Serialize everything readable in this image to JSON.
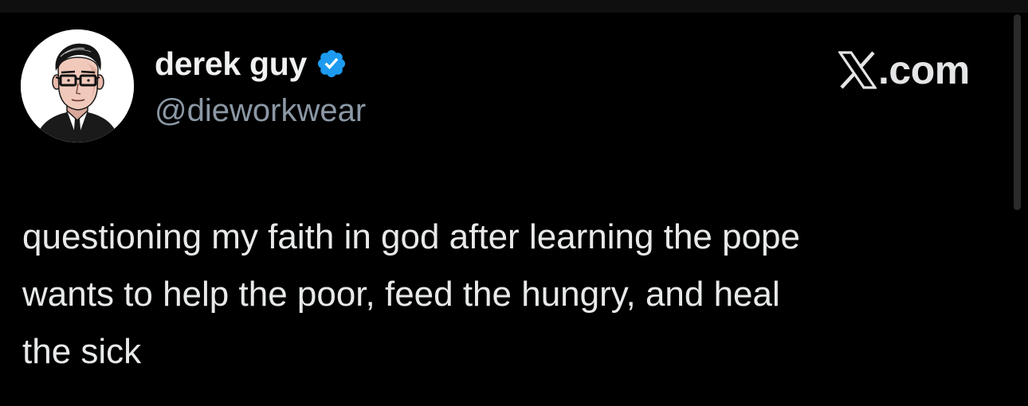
{
  "colors": {
    "background": "#000000",
    "text_primary": "#e7e9ea",
    "text_secondary": "#8b98a5",
    "verified_blue": "#1d9bf0"
  },
  "author": {
    "display_name": "derek guy",
    "handle": "@dieworkwear",
    "verified_icon": "verified-badge-icon",
    "avatar_icon": "illustrated-portrait-avatar"
  },
  "brand": {
    "icon": "x-logo-icon",
    "text": ".com"
  },
  "tweet": {
    "lines": [
      "questioning my faith in god after learning the pope",
      "wants to help the poor, feed the hungry, and heal",
      "the sick"
    ]
  }
}
